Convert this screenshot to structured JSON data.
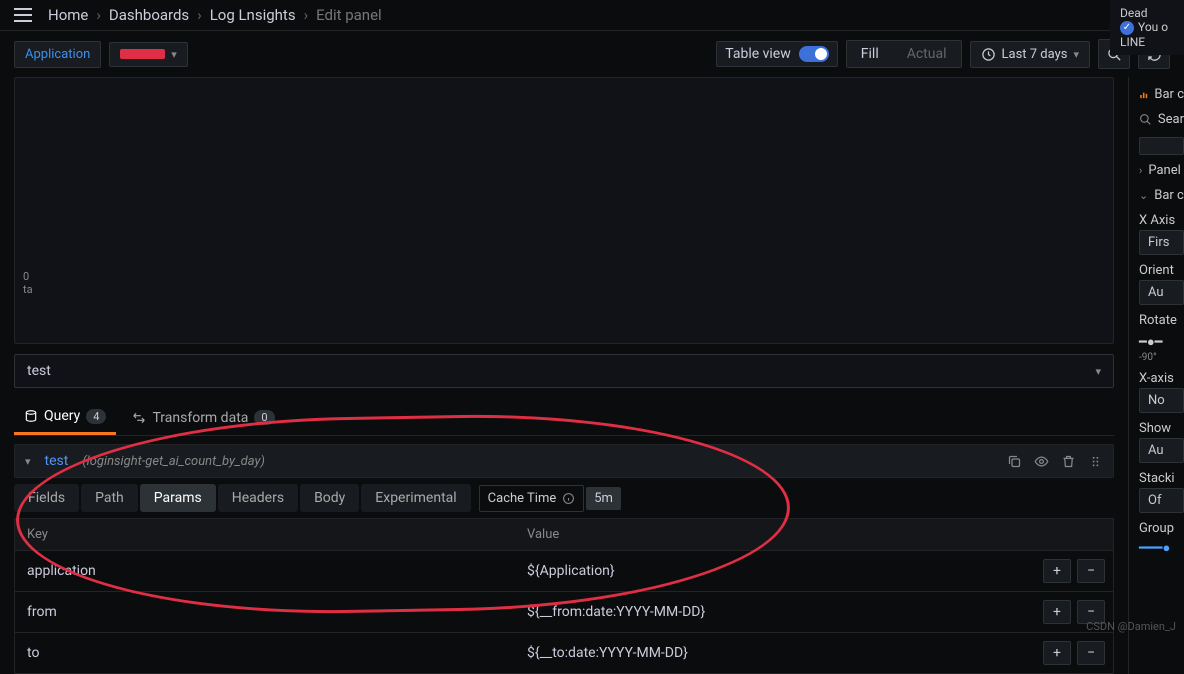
{
  "breadcrumb": {
    "home": "Home",
    "dashboards": "Dashboards",
    "page": "Log Lnsights",
    "current": "Edit panel"
  },
  "toolbar": {
    "application_btn": "Application",
    "table_view": "Table view",
    "fill": "Fill",
    "actual": "Actual",
    "time_range": "Last 7 days"
  },
  "panel": {
    "title_select": "test",
    "axis_stub1": "0",
    "axis_stub2": "ta"
  },
  "tabs": {
    "query": "Query",
    "query_count": "4",
    "transform": "Transform data",
    "transform_count": "0"
  },
  "query_row": {
    "name": "test",
    "desc": "(loginsight-get_ai_count_by_day)"
  },
  "subtabs": {
    "fields": "Fields",
    "path": "Path",
    "params": "Params",
    "headers": "Headers",
    "body": "Body",
    "experimental": "Experimental",
    "cache_label": "Cache Time",
    "cache_value": "5m"
  },
  "params_table": {
    "header_key": "Key",
    "header_value": "Value",
    "rows": [
      {
        "key": "application",
        "value": "${Application}"
      },
      {
        "key": "from",
        "value": "${__from:date:YYYY-MM-DD}"
      },
      {
        "key": "to",
        "value": "${__to:date:YYYY-MM-DD}"
      }
    ]
  },
  "sidebar": {
    "chart_type": "Bar c",
    "search_placeholder": "Sear",
    "panel_options": "Panel",
    "bar_chart": "Bar c",
    "xaxis_label": "X Axis",
    "xaxis_value": "Firs",
    "orient_label": "Orient",
    "orient_value": "Au",
    "rotate_label": "Rotate",
    "rotate_min": "-90°",
    "xaxis2_label": "X-axis",
    "xaxis2_value": "No",
    "show_label": "Show",
    "show_value": "Au",
    "stacking_label": "Stacki",
    "stacking_value": "Of",
    "group_label": "Group"
  },
  "notification": {
    "line1": "Dead",
    "line2": "You o",
    "line3": "LINE"
  },
  "watermark": "CSDN @Damien_J"
}
